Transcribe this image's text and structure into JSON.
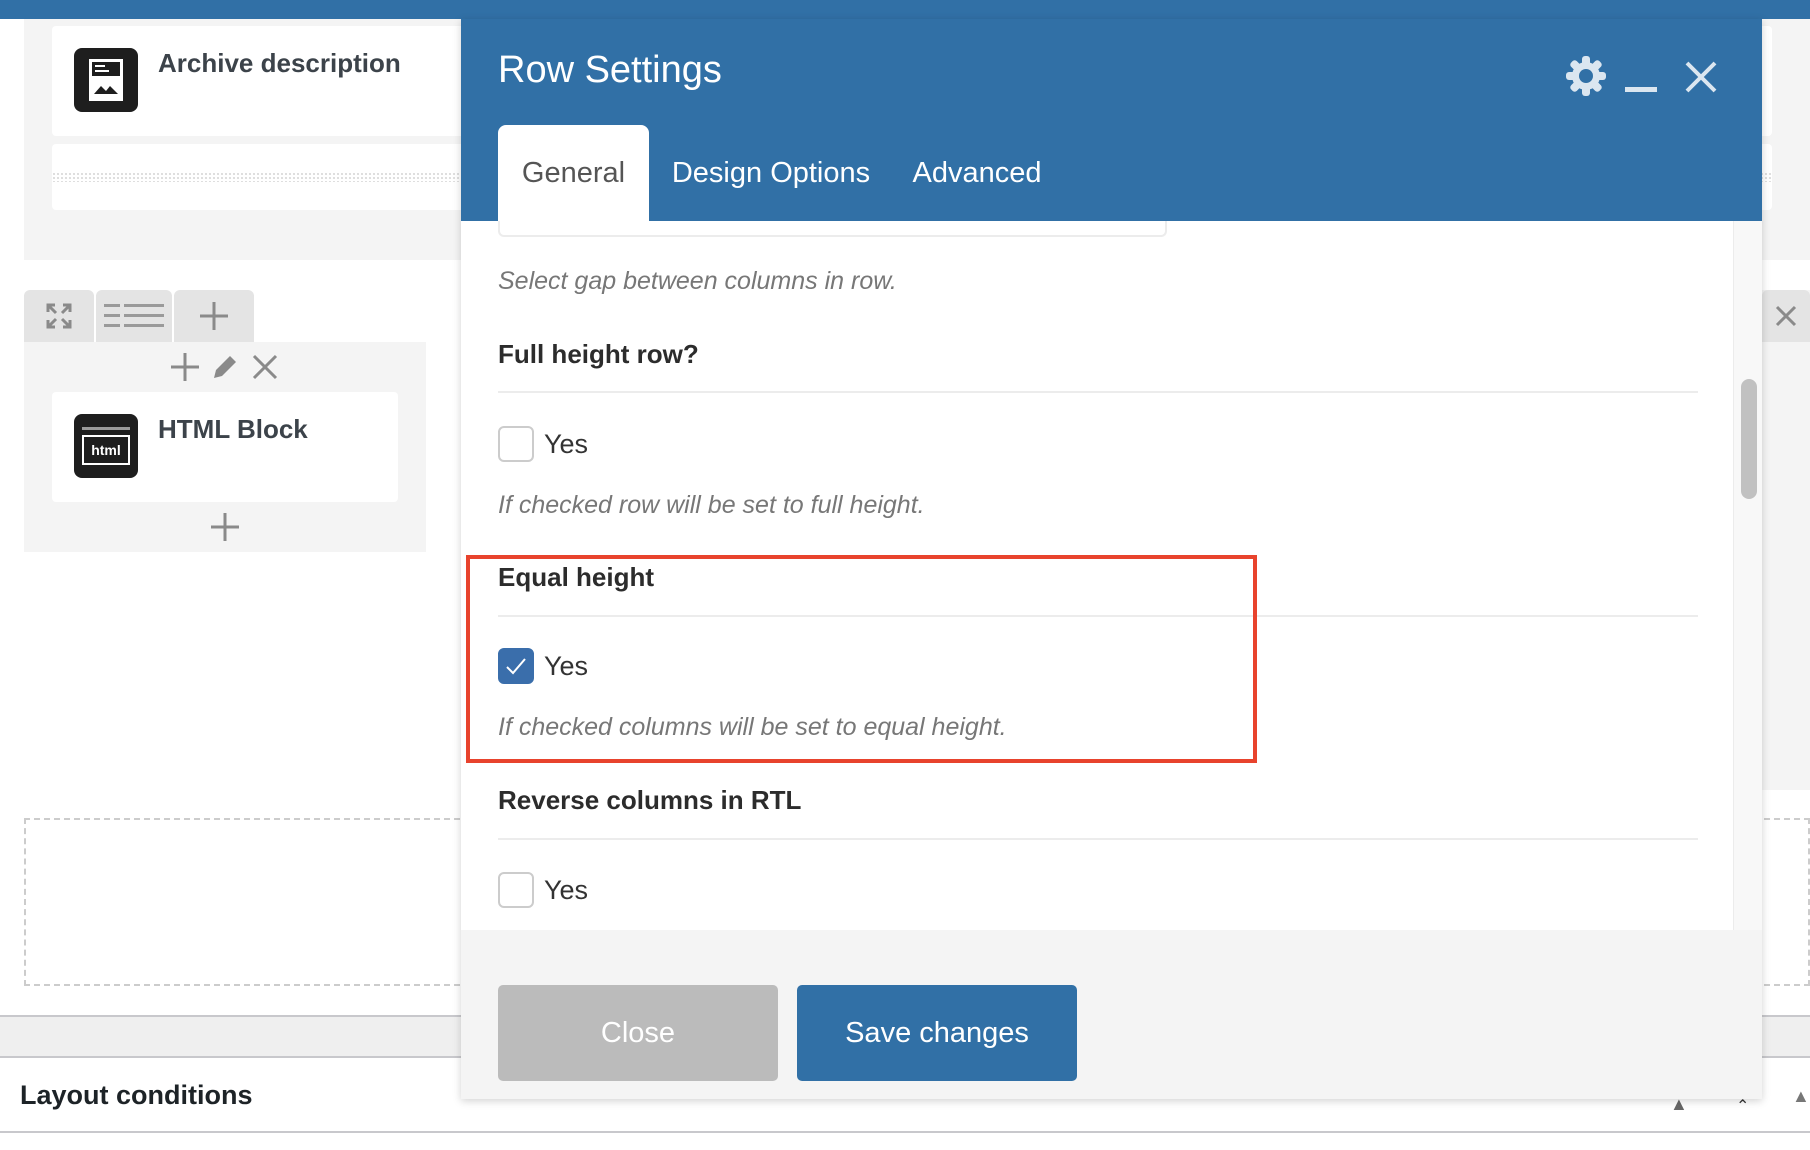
{
  "background": {
    "elements": [
      {
        "title": "Archive description",
        "icon": "archive-description-icon"
      },
      {
        "title": "HTML Block",
        "icon": "html-block-icon",
        "icon_text": "html"
      }
    ],
    "row_toolbar": {
      "icons": [
        "expand-arrows-icon",
        "list-lines-icon",
        "plus-icon"
      ]
    },
    "column_controls": [
      "plus-icon",
      "pencil-icon",
      "close-icon"
    ],
    "bottom_panel_title": "Layout conditions"
  },
  "dialog": {
    "title": "Row Settings",
    "header_icons": [
      "gear-icon",
      "minimize-icon",
      "close-icon"
    ],
    "tabs": [
      {
        "label": "General",
        "active": true
      },
      {
        "label": "Design Options",
        "active": false
      },
      {
        "label": "Advanced",
        "active": false
      }
    ],
    "fields": [
      {
        "help": "Select gap between columns in row."
      },
      {
        "label": "Full height row?",
        "checkbox_label": "Yes",
        "checked": false,
        "help": "If checked row will be set to full height."
      },
      {
        "label": "Equal height",
        "checkbox_label": "Yes",
        "checked": true,
        "help": "If checked columns will be set to equal height."
      },
      {
        "label": "Reverse columns in RTL",
        "checkbox_label": "Yes",
        "checked": false
      }
    ],
    "buttons": {
      "close": "Close",
      "save": "Save changes"
    },
    "colors": {
      "primary": "#3170a6",
      "close_button": "#bbbbbb",
      "highlight": "#e8432d"
    }
  }
}
